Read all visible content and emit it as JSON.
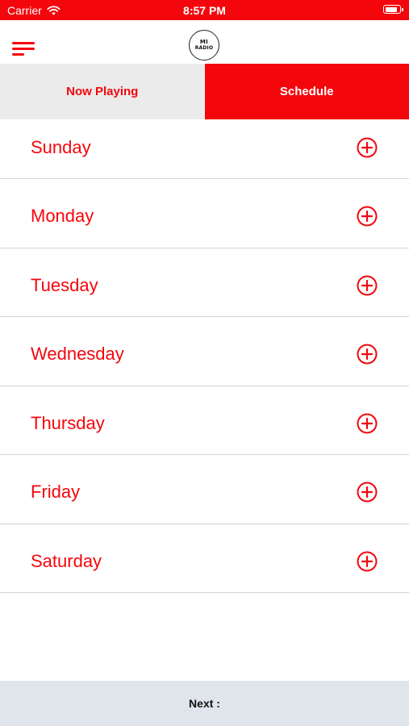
{
  "status_bar": {
    "carrier": "Carrier",
    "time": "8:57 PM",
    "battery_level": 0.9,
    "icons": [
      "wifi-icon",
      "battery-icon"
    ]
  },
  "header": {
    "menu_icon": "hamburger-menu-icon",
    "logo": {
      "top": "MI",
      "bottom": "RADIO"
    }
  },
  "tabs": [
    {
      "label": "Now Playing",
      "active": false
    },
    {
      "label": "Schedule",
      "active": true
    }
  ],
  "schedule": {
    "days": [
      {
        "label": "Sunday",
        "icon": "plus-circle-icon"
      },
      {
        "label": "Monday",
        "icon": "plus-circle-icon"
      },
      {
        "label": "Tuesday",
        "icon": "plus-circle-icon"
      },
      {
        "label": "Wednesday",
        "icon": "plus-circle-icon"
      },
      {
        "label": "Thursday",
        "icon": "plus-circle-icon"
      },
      {
        "label": "Friday",
        "icon": "plus-circle-icon"
      },
      {
        "label": "Saturday",
        "icon": "plus-circle-icon"
      }
    ]
  },
  "footer": {
    "next_label": "Next :"
  },
  "colors": {
    "accent": "#f3070d",
    "tab_inactive_bg": "#ebebeb",
    "footer_bg": "#dfe5ea",
    "divider": "#d4d4d4"
  }
}
